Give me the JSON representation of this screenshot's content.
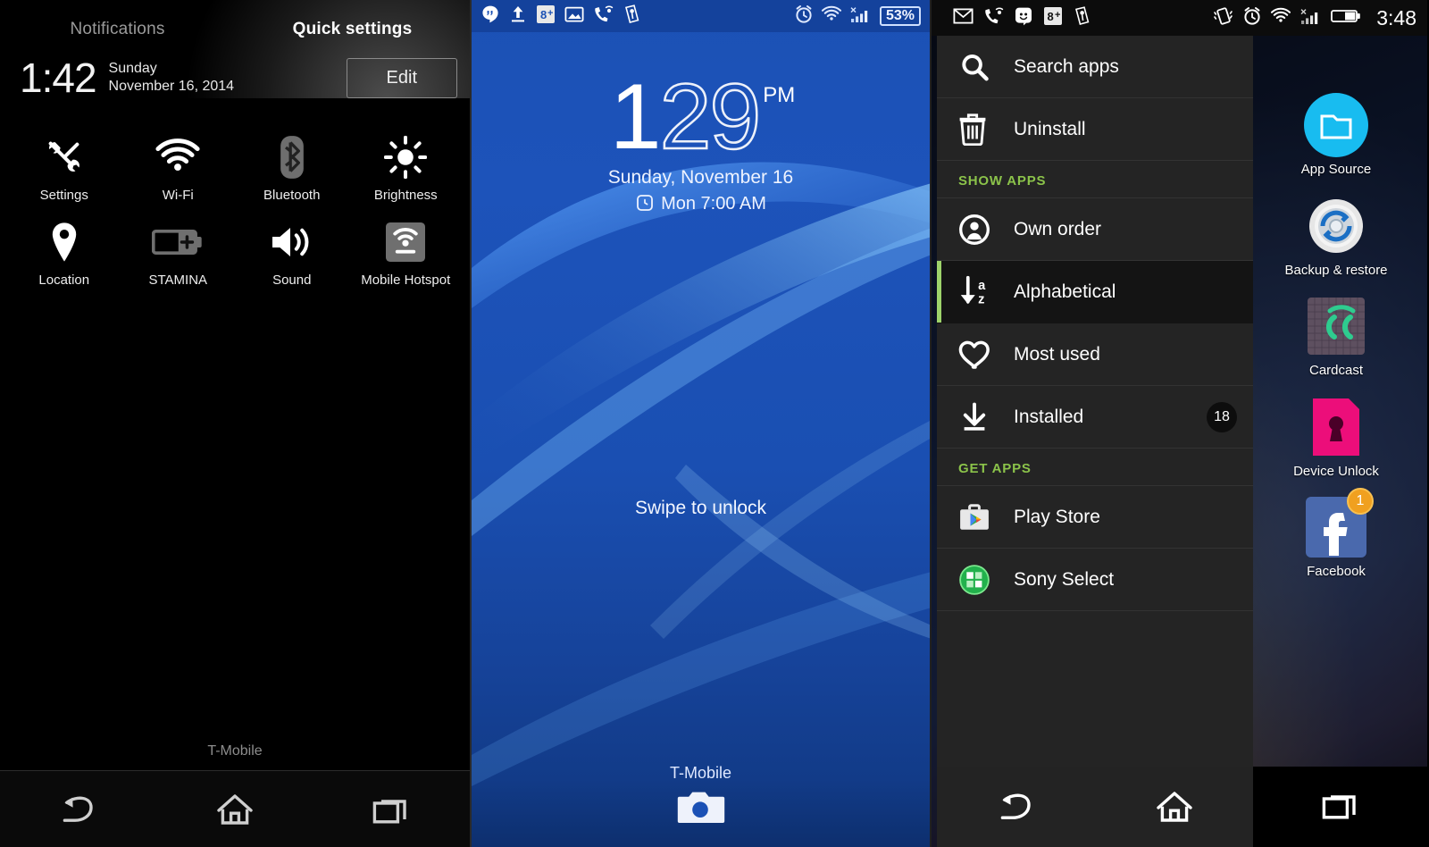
{
  "panel1": {
    "tabs": {
      "notifications": "Notifications",
      "quick_settings": "Quick settings"
    },
    "clock": {
      "time": "1:42",
      "weekday": "Sunday",
      "date": "November 16, 2014"
    },
    "edit_label": "Edit",
    "tiles": [
      {
        "label": "Settings",
        "icon": "tools-icon",
        "state": "on"
      },
      {
        "label": "Wi-Fi",
        "icon": "wifi-icon",
        "state": "on"
      },
      {
        "label": "Bluetooth",
        "icon": "bluetooth-icon",
        "state": "off"
      },
      {
        "label": "Brightness",
        "icon": "brightness-icon",
        "state": "on"
      },
      {
        "label": "Location",
        "icon": "location-pin-icon",
        "state": "on"
      },
      {
        "label": "STAMINA",
        "icon": "battery-plus-icon",
        "state": "off"
      },
      {
        "label": "Sound",
        "icon": "speaker-icon",
        "state": "on"
      },
      {
        "label": "Mobile Hotspot",
        "icon": "hotspot-icon",
        "state": "off"
      }
    ],
    "carrier": "T-Mobile",
    "nav": [
      "back-icon",
      "home-icon",
      "recents-icon"
    ]
  },
  "panel2": {
    "status_left": [
      "hangouts-icon",
      "upload-icon",
      "google-plus-icon",
      "screenshot-icon",
      "missed-call-icon",
      "key-icon"
    ],
    "status_right": [
      "alarm-icon",
      "wifi-icon",
      "signal-icon"
    ],
    "battery_text": "53%",
    "clock": {
      "hour": "1",
      "minutes": "29",
      "ampm": "PM"
    },
    "date": "Sunday, November 16",
    "alarm": "Mon 7:00 AM",
    "alarm_icon": "alarm-clock-icon",
    "swipe_hint": "Swipe to unlock",
    "carrier": "T-Mobile",
    "camera_icon": "camera-icon"
  },
  "panel3": {
    "status_left": [
      "gmail-icon",
      "missed-call-icon",
      "hangouts-icon",
      "google-plus-icon",
      "key-icon"
    ],
    "status_right": [
      "vibrate-icon",
      "alarm-icon",
      "wifi-icon",
      "signal-icon",
      "battery-icon"
    ],
    "status_time": "3:48",
    "menu": [
      {
        "type": "item",
        "label": "Search apps",
        "icon": "search-icon"
      },
      {
        "type": "item",
        "label": "Uninstall",
        "icon": "trash-icon"
      },
      {
        "type": "section",
        "label": "SHOW APPS"
      },
      {
        "type": "item",
        "label": "Own order",
        "icon": "person-circle-icon"
      },
      {
        "type": "item",
        "label": "Alphabetical",
        "icon": "sort-az-icon",
        "selected": true
      },
      {
        "type": "item",
        "label": "Most used",
        "icon": "heart-icon"
      },
      {
        "type": "item",
        "label": "Installed",
        "icon": "download-icon",
        "badge": "18"
      },
      {
        "type": "section",
        "label": "GET APPS"
      },
      {
        "type": "item",
        "label": "Play Store",
        "icon": "play-store-icon"
      },
      {
        "type": "item",
        "label": "Sony Select",
        "icon": "sony-select-icon"
      }
    ],
    "apps": [
      {
        "label": "App Source",
        "icon": "folder-app-icon"
      },
      {
        "label": "Backup & restore",
        "icon": "backup-restore-icon"
      },
      {
        "label": "Cardcast",
        "icon": "cardcast-icon"
      },
      {
        "label": "Device Unlock",
        "icon": "sim-lock-icon"
      },
      {
        "label": "Facebook",
        "icon": "facebook-icon",
        "badge": "1"
      }
    ],
    "nav": [
      "back-icon",
      "home-icon",
      "recents-icon"
    ],
    "accent_green": "#9ed36a",
    "section_green": "#8bc34a"
  }
}
